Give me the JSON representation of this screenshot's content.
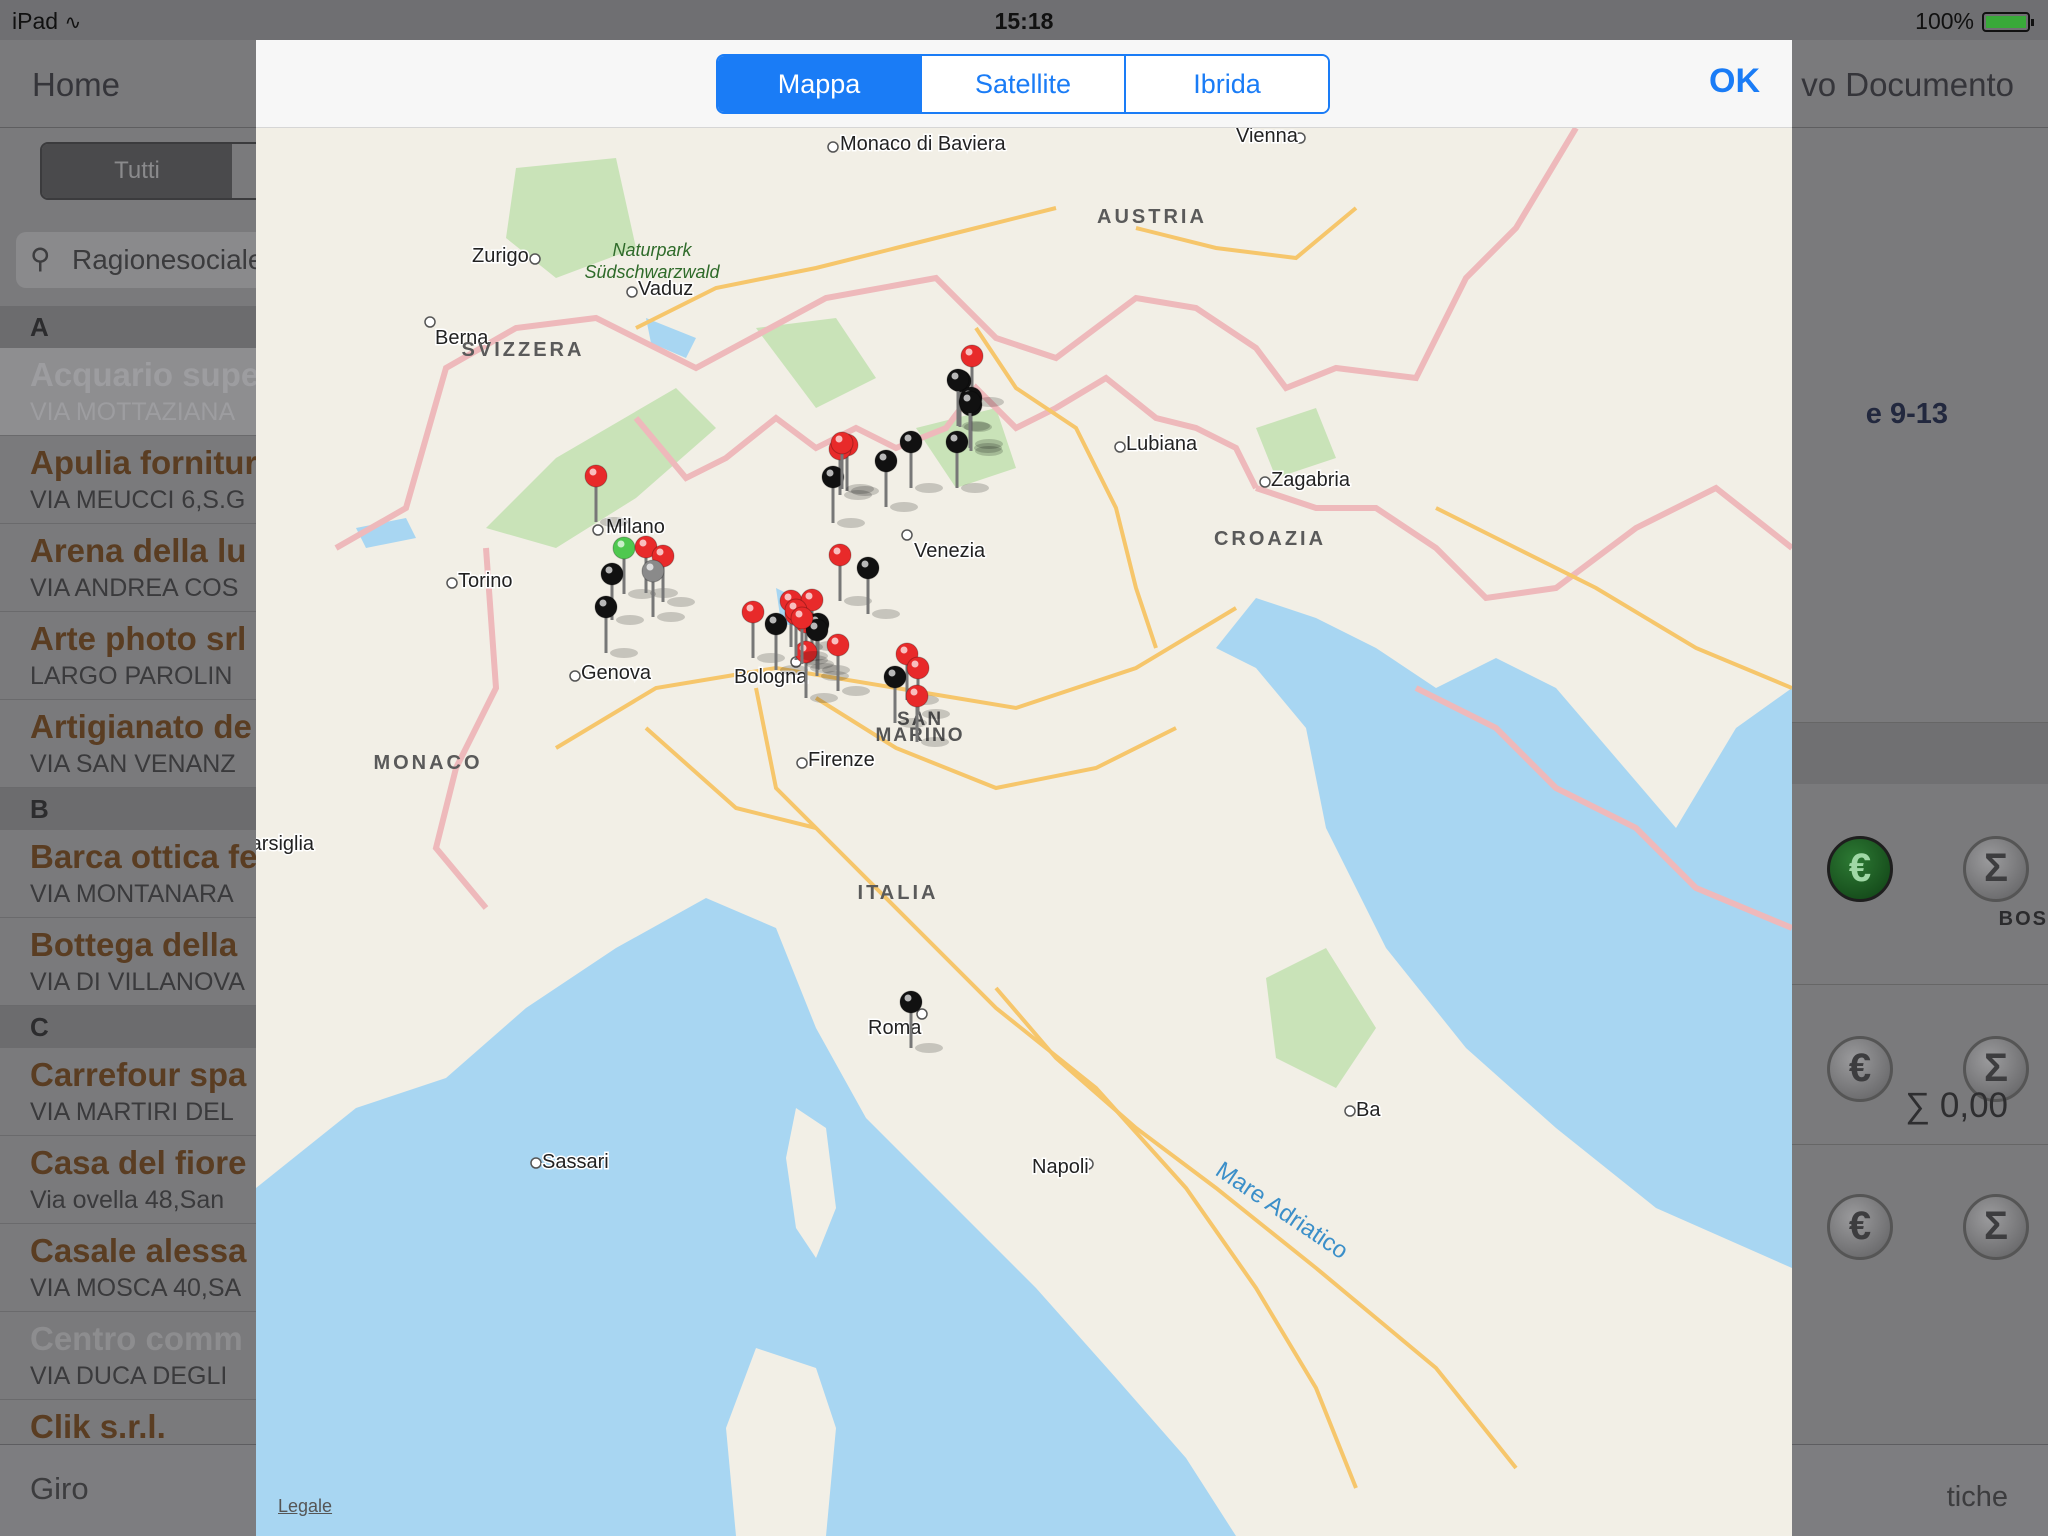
{
  "status_bar": {
    "device": "iPad",
    "time": "15:18",
    "battery": "100%",
    "battery_fraction": 1.0,
    "wifi_icon": "wifi-icon"
  },
  "master": {
    "nav_home": "Home",
    "segment_selected": "Tutti",
    "search_placeholder": "Ragionesociale",
    "sections": [
      {
        "letter": "A",
        "rows": [
          {
            "title": "Acquario supe",
            "sub": "VIA MOTTAZIANA"
          },
          {
            "title": "Apulia fornitur",
            "sub": "VIA MEUCCI 6,S.G"
          },
          {
            "title": "Arena della lu",
            "sub": "VIA ANDREA COS"
          },
          {
            "title": "Arte photo srl",
            "sub": "LARGO PAROLIN"
          },
          {
            "title": "Artigianato de",
            "sub": "VIA SAN VENANZ"
          }
        ]
      },
      {
        "letter": "B",
        "rows": [
          {
            "title": "Barca ottica fe",
            "sub": "VIA MONTANARA"
          },
          {
            "title": "Bottega della",
            "sub": "VIA DI VILLANOVA"
          }
        ]
      },
      {
        "letter": "C",
        "rows": [
          {
            "title": "Carrefour spa",
            "sub": "VIA MARTIRI DEL"
          },
          {
            "title": "Casa del fiore",
            "sub": "Via ovella 48,San"
          },
          {
            "title": "Casale alessa",
            "sub": "VIA MOSCA 40,SA"
          },
          {
            "title": "Centro comm",
            "sub": "VIA DUCA DEGLI"
          },
          {
            "title": "Clik s.r.l.",
            "sub": ""
          }
        ]
      }
    ],
    "tab_giro": "Giro"
  },
  "detail": {
    "nav_title": "vo Documento",
    "address_fragment": "e 9-13",
    "bos_fragment": "BOS",
    "euro_symbol": "€",
    "sigma_symbol": "Σ",
    "total": "∑ 0,00",
    "tab_fragment": "tiche"
  },
  "modal": {
    "segments": [
      "Mappa",
      "Satellite",
      "Ibrida"
    ],
    "active_segment": 0,
    "ok_label": "OK",
    "legal_label": "Legale"
  },
  "map": {
    "colors": {
      "sea": "#a8d6f2",
      "land": "#f2efe6",
      "park": "#c9e3b8",
      "road": "#f6c66b",
      "border": "#eeb9bb",
      "pin_red": "#e82a2a",
      "pin_black": "#111111",
      "pin_green": "#4fc84f",
      "pin_gray": "#8a8a8a"
    },
    "cities": [
      "Monaco di Baviera",
      "Vienna",
      "Zurigo",
      "Vaduz",
      "Berna",
      "Milano",
      "Torino",
      "Genova",
      "Venezia",
      "Lubiana",
      "Zagabria",
      "Bologna",
      "Firenze",
      "Marsiglia",
      "Roma",
      "Napoli",
      "Sassari",
      "Ba"
    ],
    "regions": [
      "AUSTRIA",
      "SVIZZERA",
      "CROAZIA",
      "MONACO",
      "ITALIA"
    ],
    "san_marino": [
      "SAN",
      "MARINO"
    ],
    "park": [
      "Naturpark",
      "Südschwarzwald"
    ],
    "sea_label": "Mare Adriatico",
    "pin_counts": {
      "red": 24,
      "black": 15,
      "green": 1,
      "gray": 1
    }
  }
}
